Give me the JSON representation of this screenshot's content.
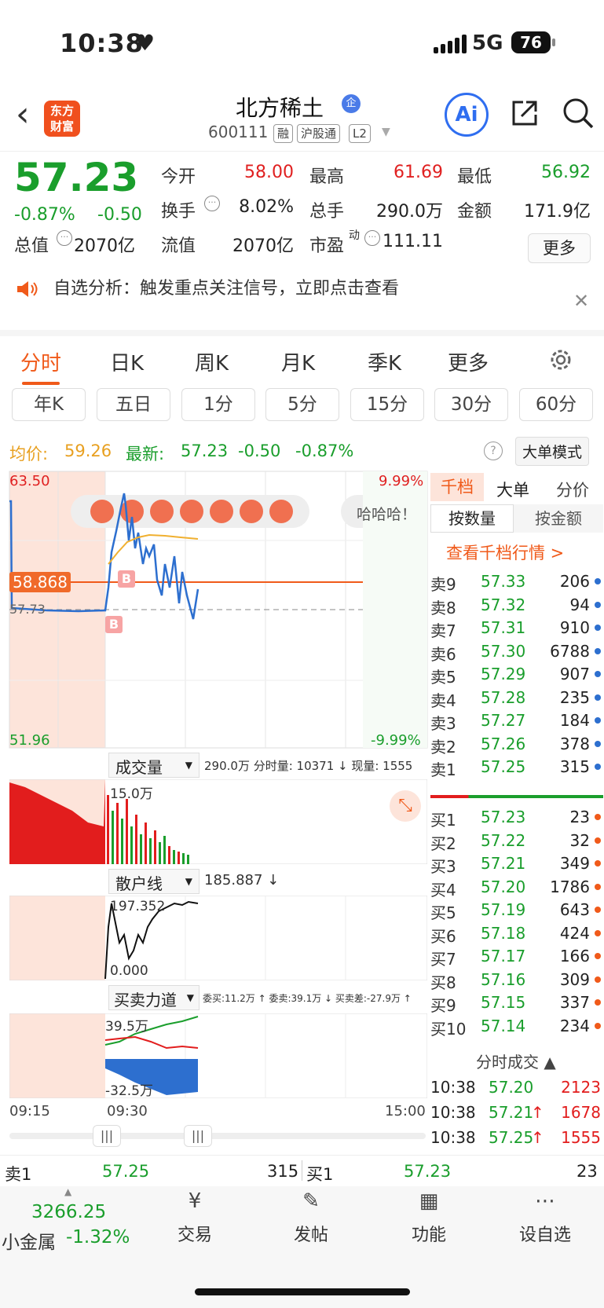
{
  "status": {
    "time": "10:38",
    "net": "5G",
    "battery": "76"
  },
  "header": {
    "name": "北方稀土",
    "badge": "企",
    "code": "600111",
    "tags": [
      "融",
      "沪股通",
      "L2"
    ],
    "logo_l1": "东方",
    "logo_l2": "财富",
    "ai": "Ai"
  },
  "quote": {
    "price": "57.23",
    "pct": "-0.87%",
    "chg": "-0.50",
    "r1": [
      {
        "l": "今开",
        "v": "58.00",
        "c": "#e02020"
      },
      {
        "l": "最高",
        "v": "61.69",
        "c": "#e02020"
      },
      {
        "l": "最低",
        "v": "56.92",
        "c": "#1a9e2c"
      }
    ],
    "r2": [
      {
        "l": "换手",
        "v": "8.02%"
      },
      {
        "l": "总手",
        "v": "290.0万"
      },
      {
        "l": "金额",
        "v": "171.9亿"
      }
    ],
    "r3": [
      {
        "l": "总值",
        "v": "2070亿"
      },
      {
        "l": "流值",
        "v": "2070亿"
      },
      {
        "l": "市盈",
        "sup": "动",
        "v": "111.11"
      }
    ],
    "more": "更多"
  },
  "notice": "自选分析：触发重点关注信号，立即点击查看",
  "tabs": [
    "分时",
    "日K",
    "周K",
    "月K",
    "季K",
    "更多"
  ],
  "periods": [
    "年K",
    "五日",
    "1分",
    "5分",
    "15分",
    "30分",
    "60分"
  ],
  "avg": {
    "avg_label": "均价:",
    "avg": "59.26",
    "last_label": "最新:",
    "last": "57.23",
    "chg": "-0.50",
    "pct": "-0.87%",
    "mode": "大单模式"
  },
  "chart": {
    "top": "63.50",
    "bottom": "51.96",
    "pct_top": "9.99%",
    "pct_bottom": "-9.99%",
    "ref": "57.73",
    "cur": "58.868",
    "haha": "哈哈哈！",
    "vol_label": "成交量",
    "vol_info": "290.0万 分时量: 10371 ↓ 现量: 1555",
    "vol_max": "15.0万",
    "retail_label": "散户线",
    "retail_val": "185.887 ↓",
    "retail_max": "197.352",
    "retail_min": "0.000",
    "force_label": "买卖力道",
    "force_info": "委买:11.2万 ↑ 委卖:39.1万 ↓ 买卖差:-27.9万 ↑",
    "force_max": "39.5万",
    "force_min": "-32.5万",
    "t_start": "09:15",
    "t_mid": "09:30",
    "t_end": "15:00"
  },
  "orderbook": {
    "tabs": [
      "千档",
      "大单",
      "分价"
    ],
    "sub": [
      "按数量",
      "按金额"
    ],
    "link": "查看千档行情 >",
    "asks": [
      [
        "卖9",
        "57.33",
        "206"
      ],
      [
        "卖8",
        "57.32",
        "94"
      ],
      [
        "卖7",
        "57.31",
        "910"
      ],
      [
        "卖6",
        "57.30",
        "6788"
      ],
      [
        "卖5",
        "57.29",
        "907"
      ],
      [
        "卖4",
        "57.28",
        "235"
      ],
      [
        "卖3",
        "57.27",
        "184"
      ],
      [
        "卖2",
        "57.26",
        "378"
      ],
      [
        "卖1",
        "57.25",
        "315"
      ]
    ],
    "bids": [
      [
        "买1",
        "57.23",
        "23"
      ],
      [
        "买2",
        "57.22",
        "32"
      ],
      [
        "买3",
        "57.21",
        "349"
      ],
      [
        "买4",
        "57.20",
        "1786"
      ],
      [
        "买5",
        "57.19",
        "643"
      ],
      [
        "买6",
        "57.18",
        "424"
      ],
      [
        "买7",
        "57.17",
        "166"
      ],
      [
        "买8",
        "57.16",
        "309"
      ],
      [
        "买9",
        "57.15",
        "337"
      ],
      [
        "买10",
        "57.14",
        "234"
      ]
    ],
    "trades_title": "分时成交 ▲",
    "trades": [
      [
        "10:38",
        "57.20",
        "",
        "2123"
      ],
      [
        "10:38",
        "57.21",
        "↑",
        "1678"
      ],
      [
        "10:38",
        "57.25",
        "↑",
        "1555"
      ]
    ]
  },
  "bottom": {
    "s_label": "卖1",
    "s_price": "57.25",
    "s_vol": "315",
    "b_label": "买1",
    "b_price": "57.23",
    "b_vol": "23"
  },
  "nav": {
    "index": "3266.25",
    "idx_name": "小金属",
    "idx_pct": "-1.32%",
    "items": [
      "交易",
      "发帖",
      "功能",
      "设自选"
    ]
  }
}
